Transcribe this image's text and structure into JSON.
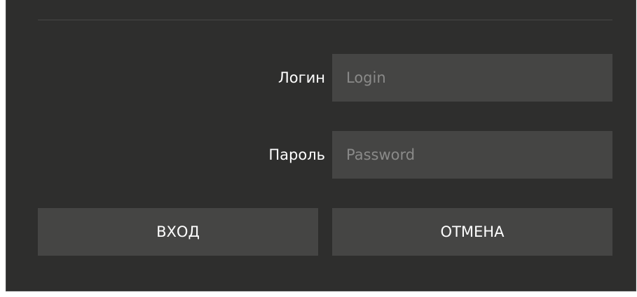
{
  "login": {
    "label": "Логин",
    "placeholder": "Login",
    "value": ""
  },
  "password": {
    "label": "Пароль",
    "placeholder": "Password",
    "value": ""
  },
  "buttons": {
    "enter_label": "ВХОД",
    "cancel_label": "ОТМЕНА"
  },
  "colors": {
    "dialog_background": "#2e2e2d",
    "input_background": "#454544",
    "text": "#ffffff",
    "placeholder": "#8a8a89"
  }
}
